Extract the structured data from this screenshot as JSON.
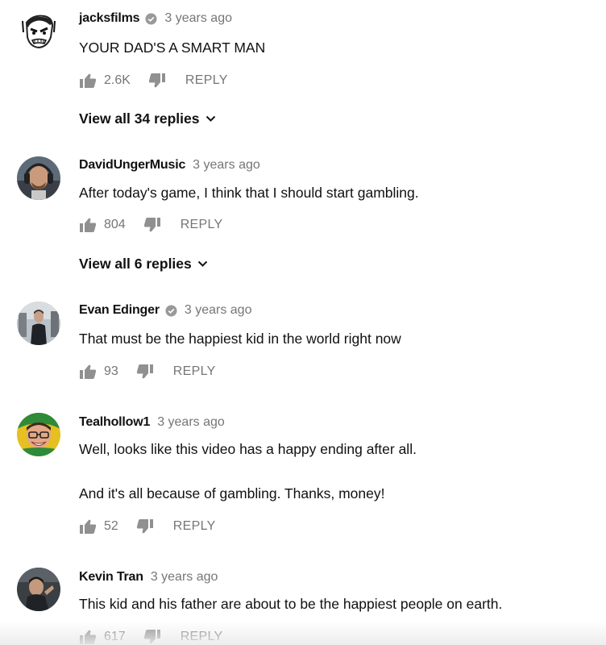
{
  "comments": [
    {
      "author": "jacksfilms",
      "verified": true,
      "time": "3 years ago",
      "lines": [
        "YOUR DAD'S A SMART MAN"
      ],
      "likes": "2.6K",
      "reply_label": "REPLY",
      "view_replies": "View all 34 replies",
      "avatar_icon": "rage-face-avatar"
    },
    {
      "author": "DavidUngerMusic",
      "verified": false,
      "time": "3 years ago",
      "lines": [
        "After today's game, I think that I should start gambling."
      ],
      "likes": "804",
      "reply_label": "REPLY",
      "view_replies": "View all 6 replies",
      "avatar_icon": "man-with-headphones-avatar"
    },
    {
      "author": "Evan Edinger",
      "verified": true,
      "time": "3 years ago",
      "lines": [
        "That must be the happiest kid in the world right now"
      ],
      "likes": "93",
      "reply_label": "REPLY",
      "avatar_icon": "man-standing-avatar"
    },
    {
      "author": "Tealhollow1",
      "verified": false,
      "time": "3 years ago",
      "lines": [
        "Well, looks like this video has a happy ending after all.",
        "And it's all because of gambling. Thanks, money!"
      ],
      "likes": "52",
      "reply_label": "REPLY",
      "avatar_icon": "smiling-man-green-avatar"
    },
    {
      "author": "Kevin Tran",
      "verified": false,
      "time": "3 years ago",
      "lines": [
        "This kid and his father are about to be the happiest people on earth."
      ],
      "likes": "617",
      "reply_label": "REPLY",
      "avatar_icon": "man-dark-avatar"
    }
  ],
  "colors": {
    "text": "#111111",
    "secondary": "#767676",
    "icon": "#909090"
  }
}
